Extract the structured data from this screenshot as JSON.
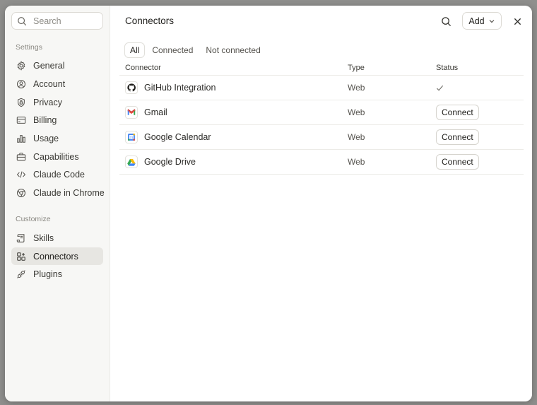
{
  "sidebar": {
    "search_placeholder": "Search",
    "settings_label": "Settings",
    "customize_label": "Customize",
    "settings_items": [
      {
        "label": "General",
        "icon": "gear-icon"
      },
      {
        "label": "Account",
        "icon": "user-circle-icon"
      },
      {
        "label": "Privacy",
        "icon": "shield-icon"
      },
      {
        "label": "Billing",
        "icon": "credit-card-icon"
      },
      {
        "label": "Usage",
        "icon": "bar-chart-icon"
      },
      {
        "label": "Capabilities",
        "icon": "briefcase-icon"
      },
      {
        "label": "Claude Code",
        "icon": "code-icon"
      },
      {
        "label": "Claude in Chrome",
        "icon": "chrome-icon"
      }
    ],
    "customize_items": [
      {
        "label": "Skills",
        "icon": "scroll-icon"
      },
      {
        "label": "Connectors",
        "icon": "connectors-grid-icon",
        "active": true
      },
      {
        "label": "Plugins",
        "icon": "plug-icon"
      }
    ]
  },
  "header": {
    "title": "Connectors",
    "add_label": "Add"
  },
  "tabs": [
    {
      "label": "All",
      "active": true
    },
    {
      "label": "Connected"
    },
    {
      "label": "Not connected"
    }
  ],
  "table": {
    "columns": [
      "Connector",
      "Type",
      "Status"
    ],
    "rows": [
      {
        "name": "GitHub Integration",
        "icon": "github-icon",
        "type": "Web",
        "status": "connected"
      },
      {
        "name": "Gmail",
        "icon": "gmail-icon",
        "type": "Web",
        "status_button": "Connect"
      },
      {
        "name": "Google Calendar",
        "icon": "google-calendar-icon",
        "type": "Web",
        "status_button": "Connect"
      },
      {
        "name": "Google Drive",
        "icon": "google-drive-icon",
        "type": "Web",
        "status_button": "Connect"
      }
    ]
  },
  "colors": {
    "active_nav_bg": "#e7e6e2",
    "sidebar_bg": "#f7f7f5",
    "backdrop": "#8f8f8d"
  }
}
